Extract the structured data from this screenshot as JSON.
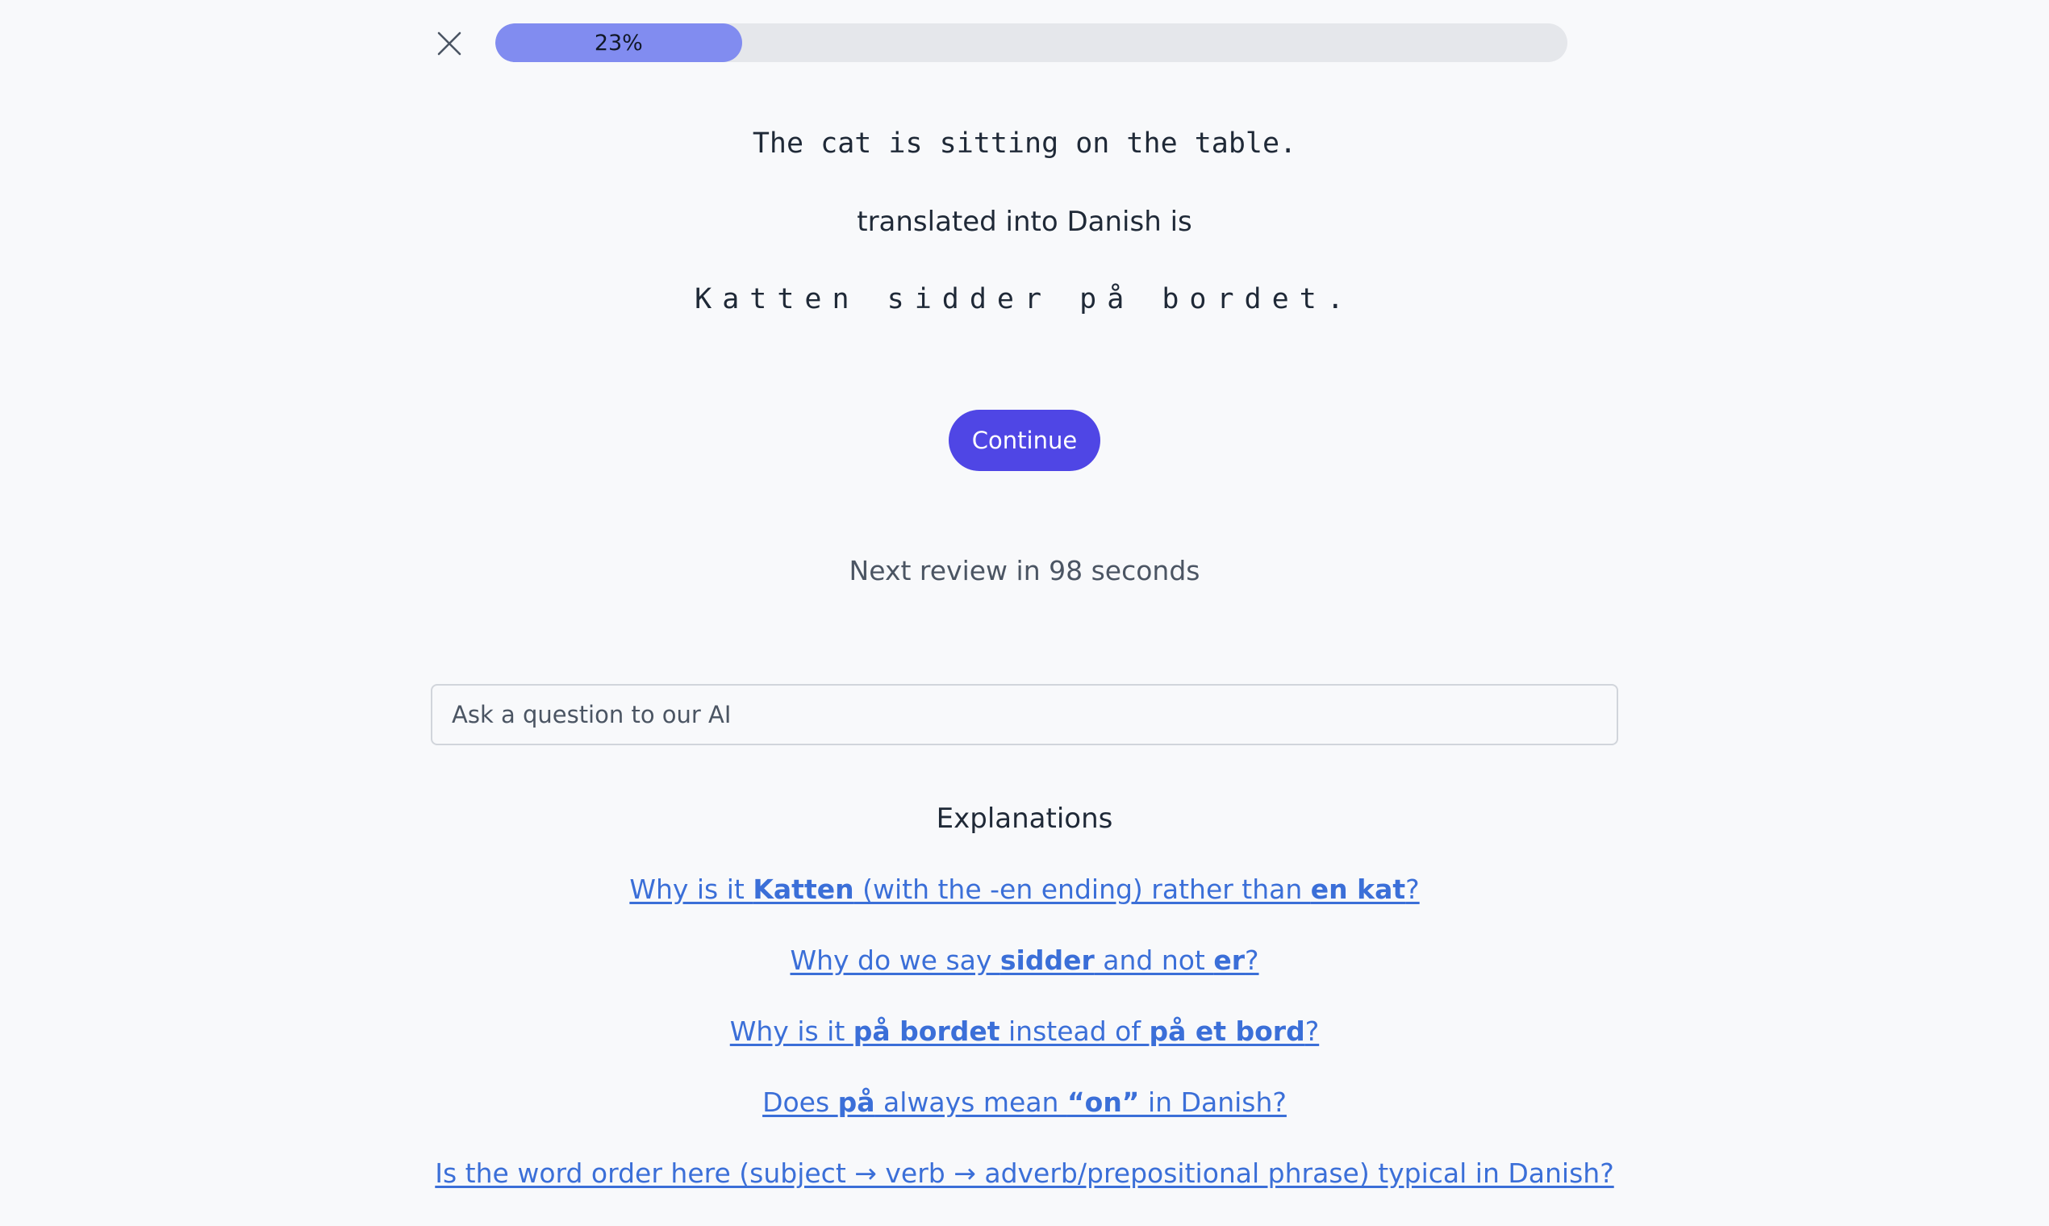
{
  "header": {
    "close_icon": "close-icon",
    "progress": {
      "percent": 23,
      "label": "23%",
      "fill_color": "#818cf0",
      "track_color": "#e5e7eb"
    }
  },
  "lesson": {
    "source_sentence": "The cat is sitting on the table.",
    "translated_label": "translated into Danish is",
    "target_sentence": "Katten sidder på bordet.",
    "continue_label": "Continue",
    "next_review": "Next review in 98 seconds"
  },
  "ask": {
    "placeholder": "Ask a question to our AI",
    "value": ""
  },
  "explanations": {
    "title": "Explanations",
    "items": [
      {
        "parts": [
          {
            "text": "Why is it ",
            "bold": false
          },
          {
            "text": "Katten",
            "bold": true
          },
          {
            "text": " (with the -en ending) rather than ",
            "bold": false
          },
          {
            "text": "en kat",
            "bold": true
          },
          {
            "text": "?",
            "bold": false
          }
        ]
      },
      {
        "parts": [
          {
            "text": "Why do we say ",
            "bold": false
          },
          {
            "text": "sidder",
            "bold": true
          },
          {
            "text": " and not ",
            "bold": false
          },
          {
            "text": "er",
            "bold": true
          },
          {
            "text": "?",
            "bold": false
          }
        ]
      },
      {
        "parts": [
          {
            "text": "Why is it ",
            "bold": false
          },
          {
            "text": "på bordet",
            "bold": true
          },
          {
            "text": " instead of ",
            "bold": false
          },
          {
            "text": "på et bord",
            "bold": true
          },
          {
            "text": "?",
            "bold": false
          }
        ]
      },
      {
        "parts": [
          {
            "text": "Does ",
            "bold": false
          },
          {
            "text": "på",
            "bold": true
          },
          {
            "text": " always mean ",
            "bold": false
          },
          {
            "text": "“on”",
            "bold": true
          },
          {
            "text": " in Danish?",
            "bold": false
          }
        ]
      },
      {
        "parts": [
          {
            "text": "Is the word order here (subject → verb → adverb/prepositional phrase) typical in Danish?",
            "bold": false
          }
        ]
      }
    ]
  },
  "colors": {
    "accent": "#4f46e5",
    "link": "#3b6fd8",
    "background": "#f8f9fb"
  }
}
